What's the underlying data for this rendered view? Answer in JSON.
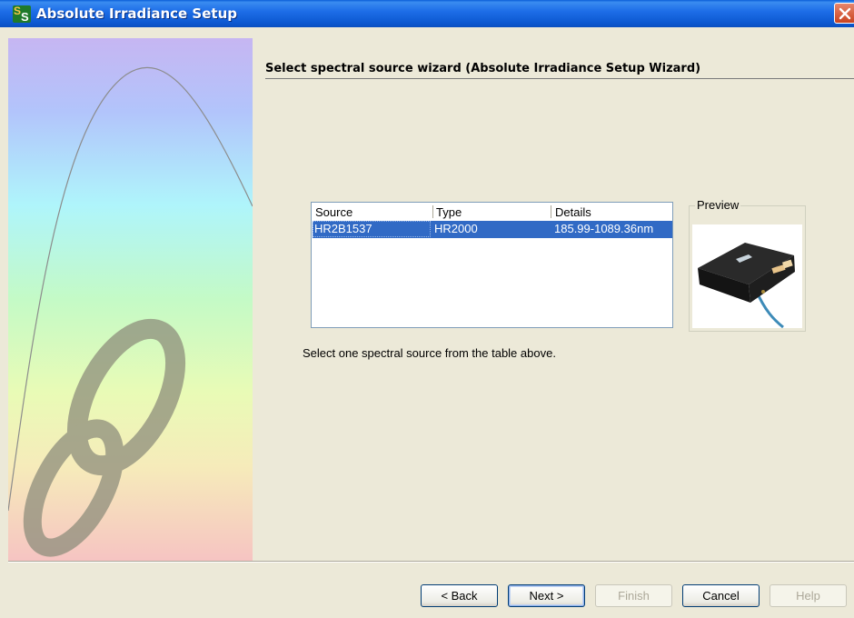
{
  "window": {
    "title": "Absolute Irradiance Setup",
    "icon": "spectrasuite-app-icon"
  },
  "header": {
    "title": "Select spectral source wizard (Absolute Irradiance Setup Wizard)"
  },
  "source_table": {
    "columns": [
      "Source",
      "Type",
      "Details"
    ],
    "rows": [
      {
        "source": "HR2B1537",
        "type": "HR2000",
        "details": "185.99-1089.36nm",
        "selected": true
      }
    ],
    "selection_color": "#316ac5"
  },
  "preview": {
    "label": "Preview",
    "image": "spectrometer-device-photo"
  },
  "hint": "Select one spectral source from the table above.",
  "buttons": {
    "back": "< Back",
    "next": "Next >",
    "finish": "Finish",
    "cancel": "Cancel",
    "help": "Help"
  },
  "colors": {
    "titlebar": "#0c58d0",
    "dialog_bg": "#ece9d8",
    "close_button": "#c9431f"
  }
}
